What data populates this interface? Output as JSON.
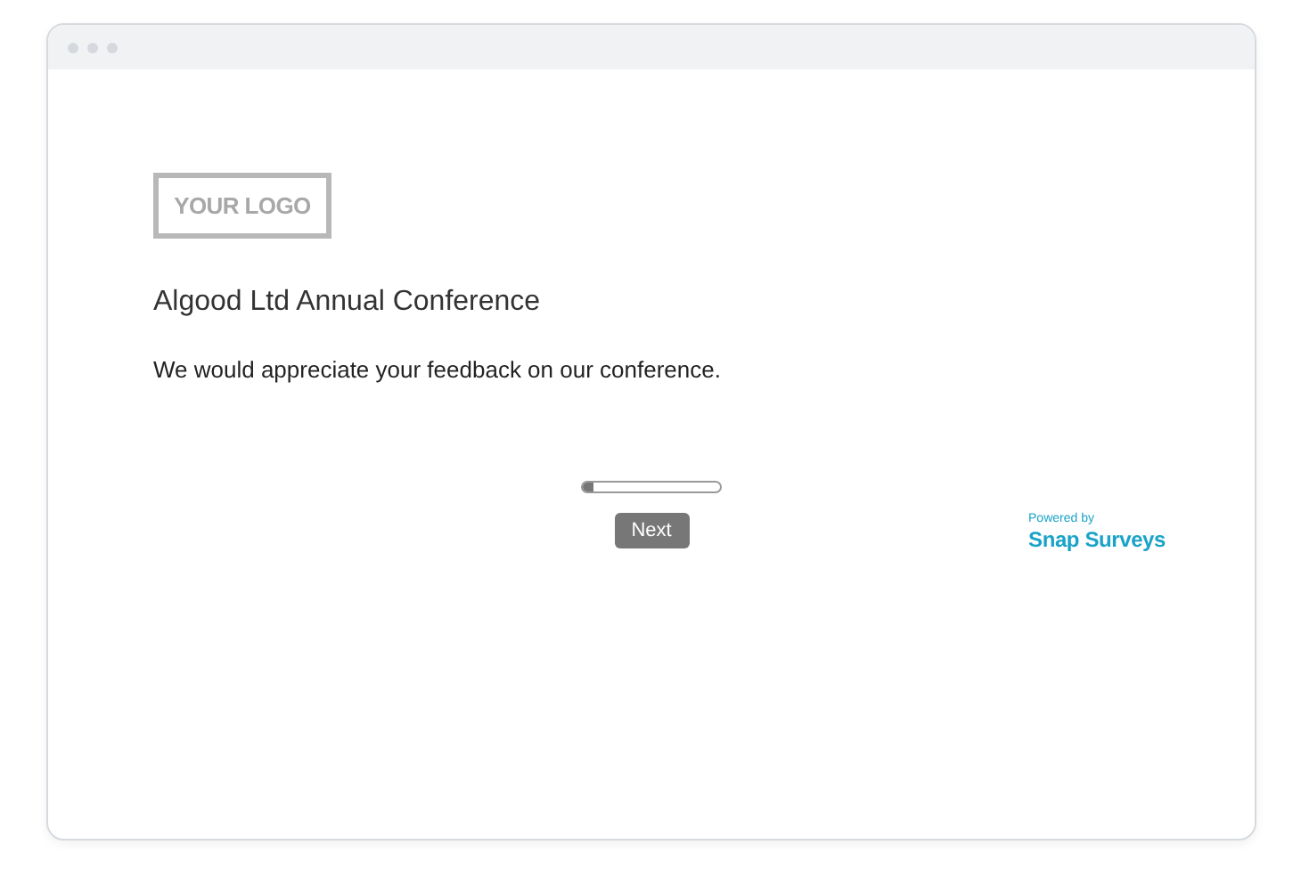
{
  "logo": {
    "text": "YOUR LOGO"
  },
  "survey": {
    "title": "Algood Ltd Annual Conference",
    "intro": "We would appreciate your feedback on our conference."
  },
  "progress": {
    "level": 0.08
  },
  "buttons": [
    {
      "label": "Next"
    }
  ],
  "branding": {
    "caption": "Powered by",
    "name": "Snap Surveys"
  }
}
